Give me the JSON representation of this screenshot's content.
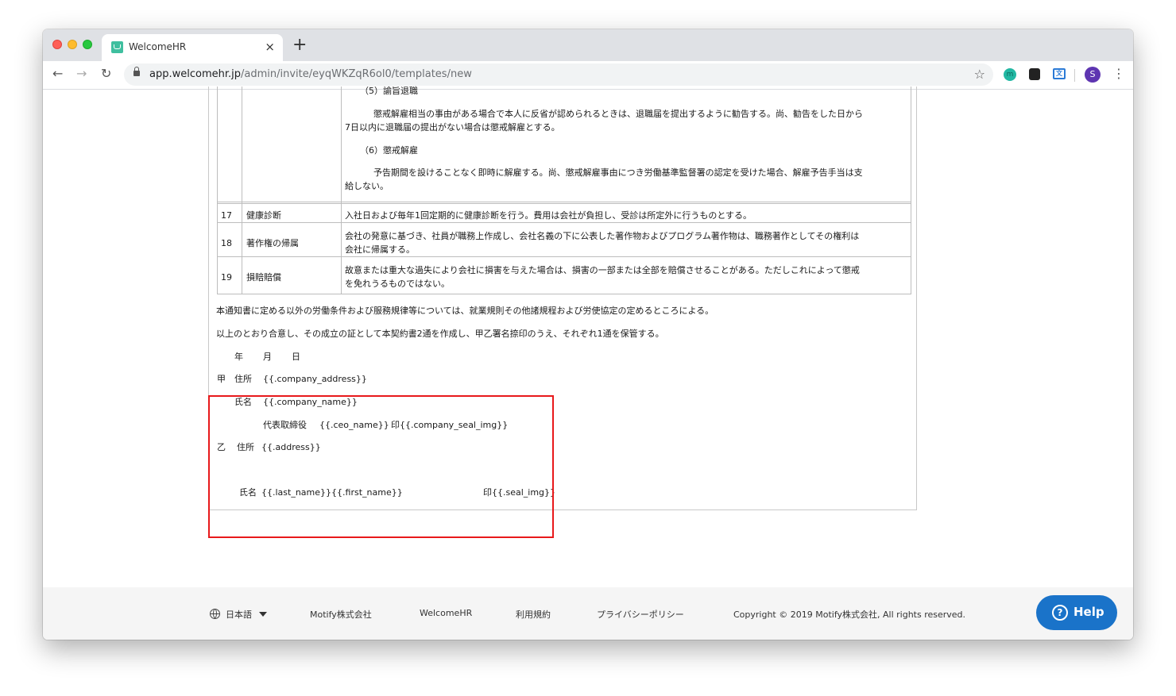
{
  "browser": {
    "tab_title": "WelcomeHR",
    "tab_close": "×",
    "new_tab": "+",
    "url_host": "app.welcomehr.jp",
    "url_path": "/admin/invite/eyqWKZqR6ol0/templates/new",
    "profile_initial": "S",
    "back": "←",
    "forward": "→",
    "reload": "↻",
    "bookmark": "☆",
    "menu": "⋮"
  },
  "document": {
    "clause_16_items": [
      {
        "heading": "（5）諭旨退職",
        "body_line1": "懲戒解雇相当の事由がある場合で本人に反省が認められるときは、退職届を提出するように勧告する。尚、勧告をした日から",
        "body_line2": "7日以内に退職届の提出がない場合は懲戒解雇とする。"
      },
      {
        "heading": "（6）懲戒解雇",
        "body_line1": "予告期間を設けることなく即時に解雇する。尚、懲戒解雇事由につき労働基準監督署の認定を受けた場合、解雇予告手当は支",
        "body_line2": "給しない。"
      }
    ],
    "rows": [
      {
        "no": "17",
        "title": "健康診断",
        "line1": "入社日および毎年1回定期的に健康診断を行う。費用は会社が負担し、受診は所定外に行うものとする。",
        "line2": ""
      },
      {
        "no": "18",
        "title": "著作権の帰属",
        "line1": "会社の発意に基づき、社員が職務上作成し、会社名義の下に公表した著作物およびプログラム著作物は、職務著作としてその権利は",
        "line2": "会社に帰属する。"
      },
      {
        "no": "19",
        "title": "損賠賠償",
        "line1": "故意または重大な過失により会社に損害を与えた場合は、損害の一部または全部を賠償させることがある。ただしこれによって懲戒",
        "line2": "を免れうるものではない。"
      }
    ],
    "para1": "本通知書に定める以外の労働条件および服務規律等については、就業規則その他諸規程および労使協定の定めるところによる。",
    "para2": "以上のとおり合意し、その成立の証として本契約書2通を作成し、甲乙署名捺印のうえ、それぞれ1通を保管する。",
    "date_line": {
      "year": "年",
      "month": "月",
      "day": "日"
    },
    "signatures": {
      "party_a": "甲",
      "address_label": "住所",
      "company_address": "{{.company_address}}",
      "name_label": "氏名",
      "company_name": "{{.company_name}}",
      "ceo_title": "代表取締役",
      "ceo_name": "{{.ceo_name}}",
      "company_seal": "印{{.company_seal_img}}",
      "party_b": "乙",
      "address_b_label": "住所",
      "address": "{{.address}}",
      "name_b_label": "氏名",
      "person_name": "{{.last_name}}{{.first_name}}",
      "seal": "印{{.seal_img}}"
    }
  },
  "footer": {
    "language": "日本語",
    "links": [
      "Motify株式会社",
      "WelcomeHR",
      "利用規約",
      "プライバシーポリシー"
    ],
    "copyright": "Copyright © 2019 Motify株式会社, All rights reserved.",
    "help": "Help"
  },
  "colors": {
    "highlight": "#e8191b",
    "help_button": "#1a73c9"
  }
}
